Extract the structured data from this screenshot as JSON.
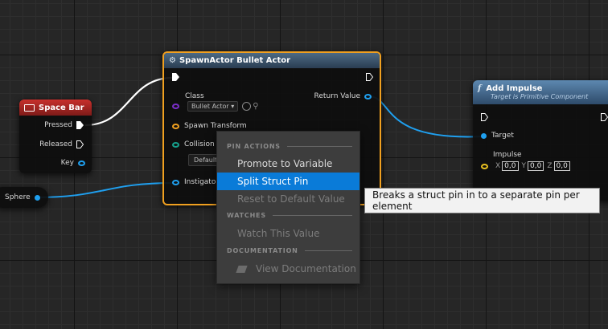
{
  "space_bar_node": {
    "title": "Space Bar",
    "pins": [
      "Pressed",
      "Released",
      "Key"
    ]
  },
  "sphere_node": {
    "label": "Sphere"
  },
  "spawn_node": {
    "title": "SpawnActor Bullet Actor",
    "class_label": "Class",
    "class_value": "Bullet Actor",
    "return_label": "Return Value",
    "spawn_transform_label": "Spawn Transform",
    "collision_label": "Collision H",
    "collision_value": "Default",
    "instigator_label": "Instigator"
  },
  "impulse_node": {
    "title": "Add Impulse",
    "subtitle": "Target is Primitive Component",
    "target_label": "Target",
    "impulse_label": "Impulse",
    "axes": [
      "X",
      "Y",
      "Z"
    ],
    "values": [
      "0,0",
      "0,0",
      "0,0"
    ]
  },
  "context_menu": {
    "sections": [
      {
        "header": "PIN ACTIONS",
        "items": [
          "Promote to Variable",
          "Split Struct Pin",
          "Reset to Default Value"
        ]
      },
      {
        "header": "WATCHES",
        "items": [
          "Watch This Value"
        ]
      },
      {
        "header": "DOCUMENTATION",
        "items": [
          "View Documentation"
        ]
      }
    ],
    "selected_item": "Split Struct Pin"
  },
  "tooltip": {
    "text": "Breaks a struct pin in to a separate pin per element"
  },
  "colors": {
    "input_event_header": "#c8302c",
    "function_header": "#4d6a84",
    "selection_border": "#f0a020",
    "object_pin": "#1fa0f0",
    "struct_pin": "#f0a020",
    "menu_highlight": "#0a7bd8"
  }
}
